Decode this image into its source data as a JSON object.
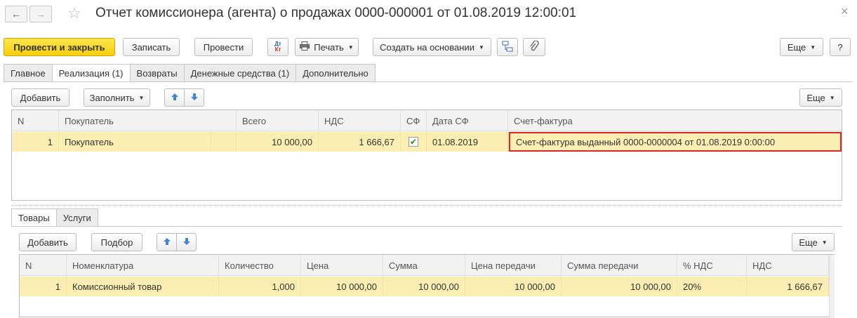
{
  "window": {
    "title": "Отчет комиссионера (агента) о продажах 0000-000001 от 01.08.2019 12:00:01",
    "close_glyph": "×"
  },
  "toolbar": {
    "post_close": "Провести и закрыть",
    "save": "Записать",
    "post": "Провести",
    "dtkt_top": "Дт",
    "dtkt_bottom": "Кт",
    "print": "Печать",
    "create_based": "Создать на основании",
    "more": "Еще",
    "help": "?"
  },
  "tabs": [
    "Главное",
    "Реализация (1)",
    "Возвраты",
    "Денежные средства (1)",
    "Дополнительно"
  ],
  "realization": {
    "add": "Добавить",
    "fill": "Заполнить",
    "more": "Еще",
    "columns": [
      "N",
      "Покупатель",
      "Всего",
      "НДС",
      "СФ",
      "Дата СФ",
      "Счет-фактура"
    ],
    "rows": [
      {
        "n": "1",
        "buyer": "Покупатель",
        "total": "10 000,00",
        "vat": "1 666,67",
        "sf_checked": true,
        "sf_date": "01.08.2019",
        "invoice": "Счет-фактура выданный 0000-0000004 от 01.08.2019 0:00:00"
      }
    ]
  },
  "subtabs": [
    "Товары",
    "Услуги"
  ],
  "goods": {
    "add": "Добавить",
    "pick": "Подбор",
    "more": "Еще",
    "columns": [
      "N",
      "Номенклатура",
      "Количество",
      "Цена",
      "Сумма",
      "Цена передачи",
      "Сумма передачи",
      "% НДС",
      "НДС"
    ],
    "rows": [
      {
        "n": "1",
        "item": "Комиссионный товар",
        "qty": "1,000",
        "price": "10 000,00",
        "sum": "10 000,00",
        "transfer_price": "10 000,00",
        "transfer_sum": "10 000,00",
        "vat_rate": "20%",
        "vat": "1 666,67"
      }
    ]
  },
  "colors": {
    "primary": "#f5cf0a",
    "selected_row": "#fbeeb3",
    "highlight_border": "#d9262b"
  }
}
